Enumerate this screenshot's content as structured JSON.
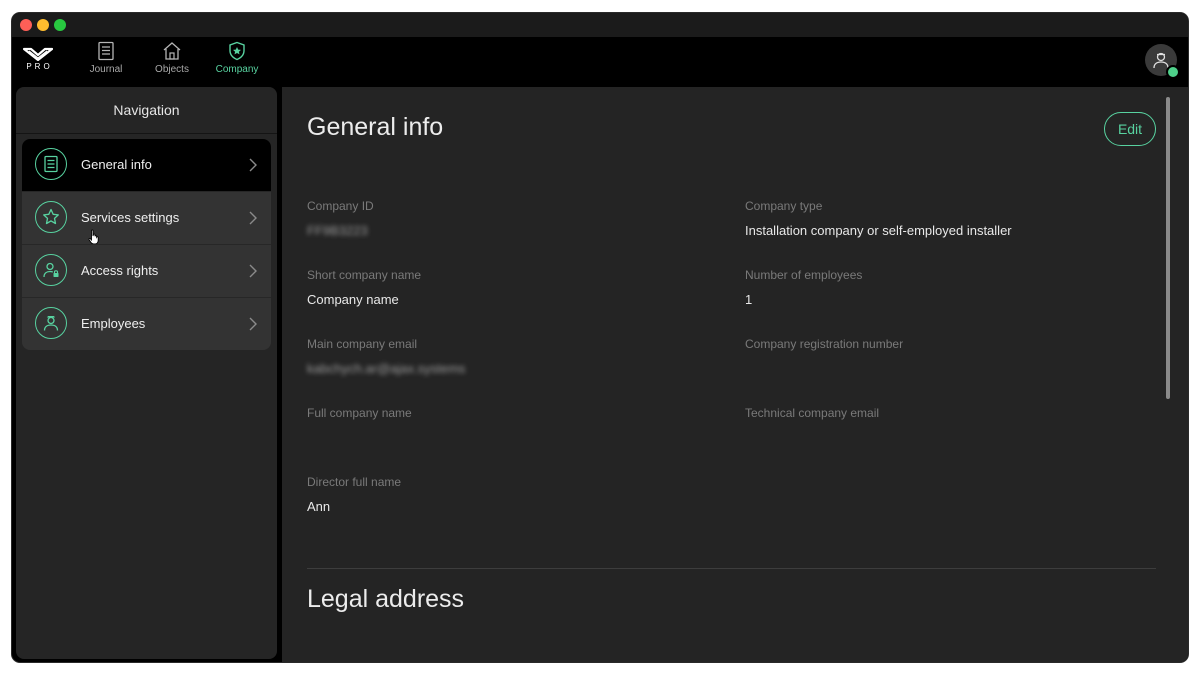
{
  "app": {
    "logo_text": "PRO"
  },
  "topnav": {
    "tabs": [
      {
        "label": "Journal",
        "icon": "journal-icon",
        "active": false
      },
      {
        "label": "Objects",
        "icon": "house-icon",
        "active": false
      },
      {
        "label": "Company",
        "icon": "shield-star-icon",
        "active": true
      }
    ]
  },
  "user": {
    "status": "online",
    "status_color": "#4fd18b"
  },
  "sidebar": {
    "title": "Navigation",
    "items": [
      {
        "label": "General info",
        "icon": "document-icon",
        "active": true
      },
      {
        "label": "Services settings",
        "icon": "star-icon",
        "active": false
      },
      {
        "label": "Access rights",
        "icon": "user-lock-icon",
        "active": false
      },
      {
        "label": "Employees",
        "icon": "employee-icon",
        "active": false
      }
    ]
  },
  "main": {
    "title": "General info",
    "edit_label": "Edit",
    "fields": {
      "company_id": {
        "label": "Company ID",
        "value": "FF9B3223"
      },
      "company_type": {
        "label": "Company type",
        "value": "Installation company or self-employed installer"
      },
      "short_name": {
        "label": "Short company name",
        "value": "Company name"
      },
      "employees_count": {
        "label": "Number of employees",
        "value": "1"
      },
      "main_email": {
        "label": "Main company email",
        "value": "kabchych.ar@ajax.systems"
      },
      "registration_number": {
        "label": "Company registration number",
        "value": ""
      },
      "full_name": {
        "label": "Full company name",
        "value": ""
      },
      "tech_email": {
        "label": "Technical company email",
        "value": ""
      },
      "director": {
        "label": "Director full name",
        "value": "Ann"
      }
    },
    "legal_section_title": "Legal address"
  },
  "colors": {
    "accent": "#58d2a0",
    "background": "#242424",
    "sidebar": "#252525"
  }
}
